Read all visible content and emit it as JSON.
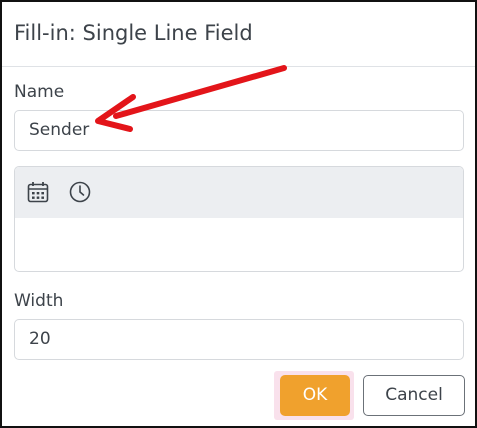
{
  "dialog": {
    "title": "Fill-in: Single Line Field"
  },
  "name_field": {
    "label": "Name",
    "value": "Sender"
  },
  "format_toolbar": {
    "icons": [
      "calendar-icon",
      "clock-icon"
    ]
  },
  "width_field": {
    "label": "Width",
    "value": "20"
  },
  "buttons": {
    "ok_label": "OK",
    "cancel_label": "Cancel"
  },
  "colors": {
    "ok_button": "#f0a12d",
    "annotation_arrow": "#e3151a",
    "toolbar_bg": "#eceef1"
  }
}
